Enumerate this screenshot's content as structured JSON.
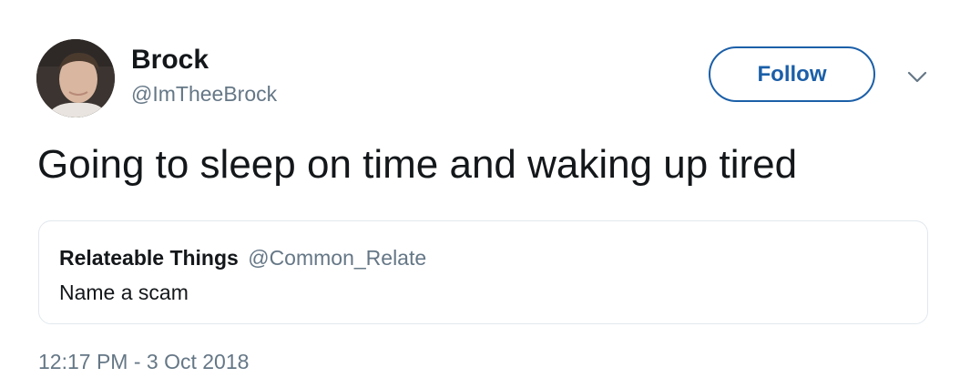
{
  "author": {
    "name": "Brock",
    "handle": "@ImTheeBrock",
    "avatar_icon": "profile-photo"
  },
  "actions": {
    "follow_label": "Follow",
    "more_icon": "chevron-down-icon"
  },
  "tweet": {
    "text": "Going to sleep on time and waking up tired",
    "timestamp": "12:17 PM - 3 Oct 2018"
  },
  "quoted_tweet": {
    "name": "Relateable Things",
    "handle": "@Common_Relate",
    "text": "Name a scam"
  },
  "colors": {
    "accent": "#1b5fa8",
    "text_primary": "#14171a",
    "text_secondary": "#657786",
    "border": "#e1e8ed"
  }
}
